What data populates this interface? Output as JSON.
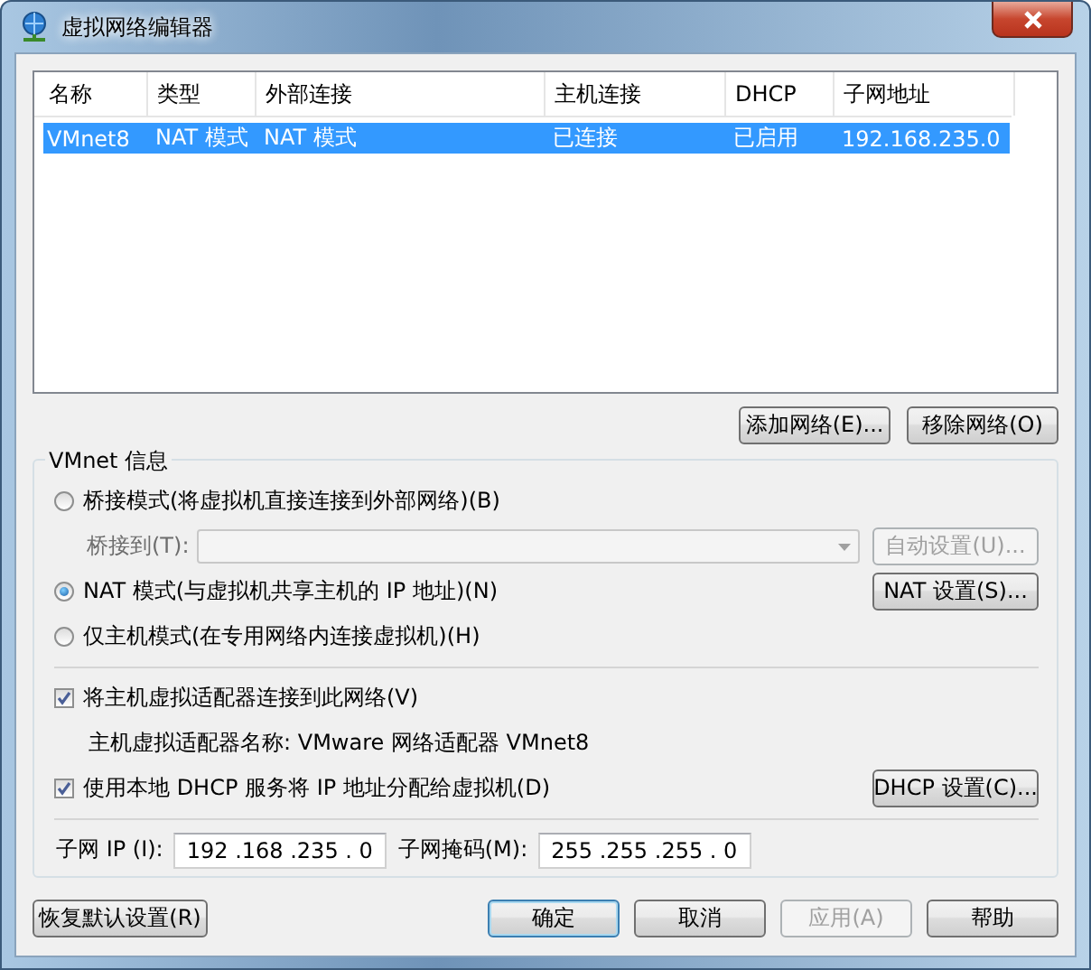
{
  "window": {
    "title": "虚拟网络编辑器"
  },
  "network_table": {
    "columns": [
      "名称",
      "类型",
      "外部连接",
      "主机连接",
      "DHCP",
      "子网地址"
    ],
    "rows": [
      {
        "cells": [
          "VMnet8",
          "NAT 模式",
          "NAT 模式",
          "已连接",
          "已启用",
          "192.168.235.0"
        ],
        "selected": true
      }
    ]
  },
  "list_buttons": [
    {
      "label": "添加网络(E)...",
      "disabled": false
    },
    {
      "label": "移除网络(O)",
      "disabled": false
    }
  ],
  "vmnet_info": {
    "title": "VMnet 信息",
    "modes": [
      {
        "label": "桥接模式(将虚拟机直接连接到外部网络)(B)",
        "selected": false,
        "bridge_to": {
          "label": "桥接到(T):",
          "disabled": true
        },
        "button": {
          "label": "自动设置(U)...",
          "disabled": true
        }
      },
      {
        "label": "NAT 模式(与虚拟机共享主机的 IP 地址)(N)",
        "selected": true,
        "button": {
          "label": "NAT 设置(S)...",
          "disabled": false
        }
      },
      {
        "label": "仅主机模式(在专用网络内连接虚拟机)(H)",
        "selected": false
      }
    ],
    "connect_adapter": {
      "label": "将主机虚拟适配器连接到此网络(V)",
      "checked": true,
      "adapter_name": "主机虚拟适配器名称: VMware 网络适配器 VMnet8"
    },
    "use_dhcp": {
      "label": "使用本地 DHCP 服务将 IP 地址分配给虚拟机(D)",
      "checked": true,
      "button": {
        "label": "DHCP 设置(C)...",
        "disabled": false
      }
    },
    "subnet_ip": {
      "label": "子网 IP (I):",
      "value": "192 .168 .235 . 0"
    },
    "subnet_mask": {
      "label": "子网掩码(M):",
      "value": "255 .255 .255 . 0"
    }
  },
  "footer_buttons": [
    {
      "label": "恢复默认设置(R)",
      "disabled": false,
      "default": false
    },
    {
      "label": "确定",
      "disabled": false,
      "default": true
    },
    {
      "label": "取消",
      "disabled": false,
      "default": false
    },
    {
      "label": "应用(A)",
      "disabled": true,
      "default": false
    },
    {
      "label": "帮助",
      "disabled": false,
      "default": false
    }
  ]
}
